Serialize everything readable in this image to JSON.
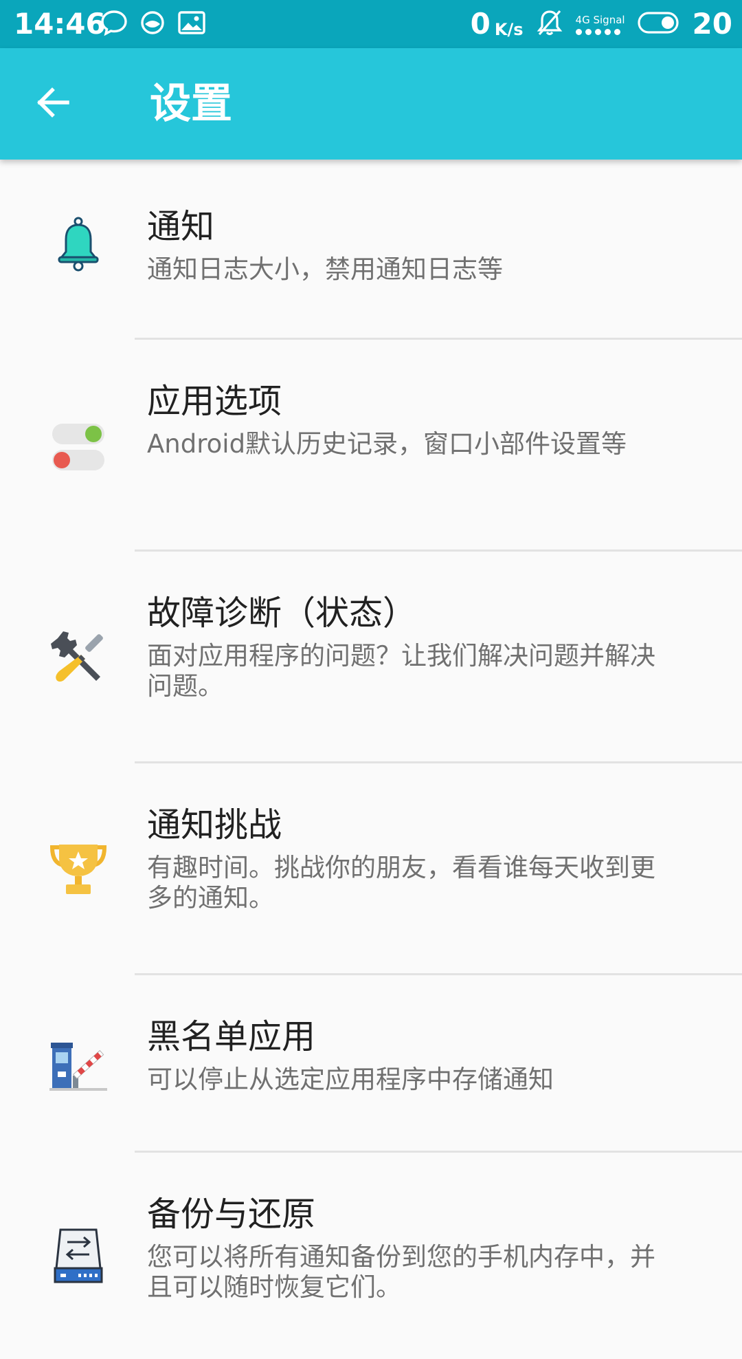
{
  "status_bar": {
    "time": "14:46",
    "icons_left": [
      "chat-bubble-icon",
      "sync-icon",
      "image-icon"
    ],
    "net_speed_value": "0",
    "net_speed_unit": "K/s",
    "signal_label": "4G Signal",
    "battery_level": "20"
  },
  "app_bar": {
    "title": "设置",
    "back_icon": "arrow-left-icon"
  },
  "settings": [
    {
      "title": "通知",
      "subtitle": "通知日志大小，禁用通知日志等",
      "icon": "bell-icon"
    },
    {
      "title": "应用选项",
      "subtitle": "Android默认历史记录，窗口小部件设置等",
      "icon": "toggle-switches-icon"
    },
    {
      "title": "故障诊断（状态）",
      "subtitle": "面对应用程序的问题？让我们解决问题并解决问题。",
      "icon": "tools-icon"
    },
    {
      "title": "通知挑战",
      "subtitle": "有趣时间。挑战你的朋友，看看谁每天收到更多的通知。",
      "icon": "trophy-icon"
    },
    {
      "title": "黑名单应用",
      "subtitle": "可以停止从选定应用程序中存储通知",
      "icon": "barrier-gate-icon"
    },
    {
      "title": "备份与还原",
      "subtitle": "您可以将所有通知备份到您的手机内存中，并且可以随时恢复它们。",
      "icon": "backup-drive-icon"
    }
  ],
  "colors": {
    "status_bar": "#0aa6bb",
    "app_bar": "#26c6da",
    "background": "#fafafa",
    "title_text": "#212121",
    "subtitle_text": "#707070"
  }
}
